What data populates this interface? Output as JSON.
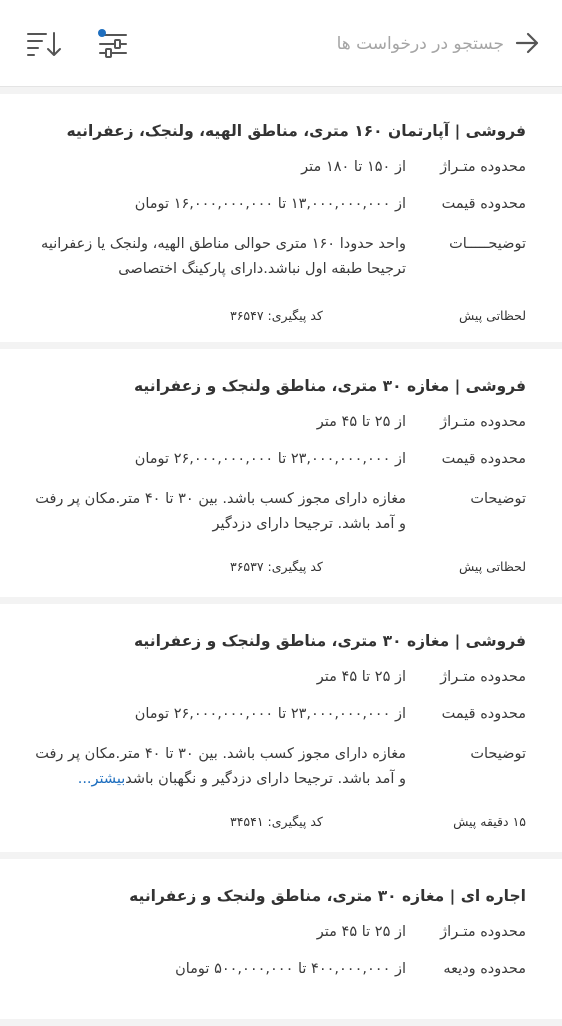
{
  "header": {
    "search_placeholder": "جستجو در درخواست ها",
    "back_icon": "arrow-right-icon",
    "filter_icon": "sliders-icon",
    "sort_icon": "sort-descending-icon",
    "accent_color": "#1f6fbf"
  },
  "cards": [
    {
      "title": "فروشی | آپارتمان ۱۶۰ متری، مناطق الهیه، ولنجک، زعفرانیه",
      "area_label": "محدوده متـراژ",
      "area_value": "از ۱۵۰ تا ۱۸۰ متر",
      "price_label": "محدوده قیمت",
      "price_value": "از ۱۳,۰۰۰,۰۰۰,۰۰۰ تا ۱۶,۰۰۰,۰۰۰,۰۰۰ تومان",
      "desc_label": "توضیحـــــات",
      "desc_value": "واحد حدودا ۱۶۰ متری حوالی مناطق الهیه، ولنجک یا زعفرانیه ترجیحا طبقه اول نباشد.دارای پارکینگ اختصاصی",
      "more": "",
      "code": "کد پیگیری: ۳۶۵۴۷",
      "time": "لحظاتی پیش"
    },
    {
      "title": "فروشی | مغازه ۳۰ متری، مناطق ولنجک و زعفرانیه",
      "area_label": "محدوده متـراژ",
      "area_value": "از ۲۵ تا ۴۵ متر",
      "price_label": "محدوده قیمت",
      "price_value": "از ۲۳,۰۰۰,۰۰۰,۰۰۰ تا ۲۶,۰۰۰,۰۰۰,۰۰۰ تومان",
      "desc_label": "توضیحات",
      "desc_value": "مغازه دارای مجوز کسب باشد. بین ۳۰ تا ۴۰ متر.مکان پر رفت و آمد باشد. ترجیحا دارای دزدگیر",
      "more": "",
      "code": "کد پیگیری: ۳۶۵۳۷",
      "time": "لحظاتی پیش"
    },
    {
      "title": "فروشی | مغازه ۳۰ متری، مناطق ولنجک و زعفرانیه",
      "area_label": "محدوده متـراژ",
      "area_value": "از ۲۵ تا ۴۵ متر",
      "price_label": "محدوده قیمت",
      "price_value": "از ۲۳,۰۰۰,۰۰۰,۰۰۰ تا ۲۶,۰۰۰,۰۰۰,۰۰۰ تومان",
      "desc_label": "توضیحات",
      "desc_value": "مغازه دارای مجوز کسب باشد. بین ۳۰ تا ۴۰ متر.مکان پر رفت و آمد باشد. ترجیحا دارای دزدگیر و نگهبان باشد",
      "more": "بیشتر...",
      "code": "کد پیگیری: ۳۴۵۴۱",
      "time": "۱۵ دقیقه پیش"
    },
    {
      "title": "اجاره ای | مغازه ۳۰ متری، مناطق ولنجک و زعفرانیه",
      "area_label": "محدوده متـراژ",
      "area_value": "از ۲۵ تا ۴۵ متر",
      "price_label": "محدوده ودیعه",
      "price_value": "از ۴۰۰,۰۰۰,۰۰۰ تا ۵۰۰,۰۰۰,۰۰۰ تومان"
    }
  ]
}
